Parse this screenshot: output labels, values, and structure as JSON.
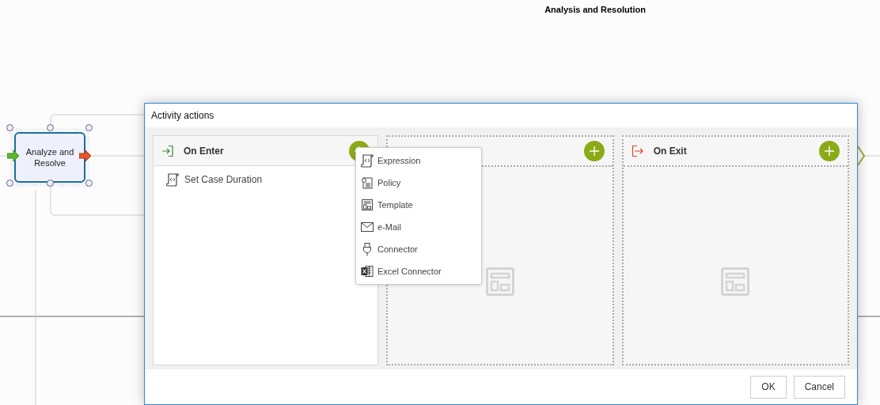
{
  "page": {
    "title": "Analysis and Resolution"
  },
  "diagram": {
    "node": {
      "label": "Analyze and Resolve",
      "selected": true
    }
  },
  "dialog": {
    "title": "Activity actions",
    "panels": [
      {
        "kind": "enter",
        "title": "On Enter",
        "active": true,
        "actions": [
          {
            "label": "Set Case Duration"
          }
        ]
      },
      {
        "kind": "middle",
        "active": false
      },
      {
        "kind": "exit",
        "title": "On Exit",
        "active": false
      }
    ],
    "menu": [
      {
        "kind": "expression",
        "label": "Expression"
      },
      {
        "kind": "policy",
        "label": "Policy"
      },
      {
        "kind": "template",
        "label": "Template"
      },
      {
        "kind": "email",
        "label": "e-Mail"
      },
      {
        "kind": "connector",
        "label": "Connector"
      },
      {
        "kind": "excel",
        "label": "Excel Connector"
      }
    ],
    "buttons": [
      "OK",
      "Cancel"
    ]
  }
}
